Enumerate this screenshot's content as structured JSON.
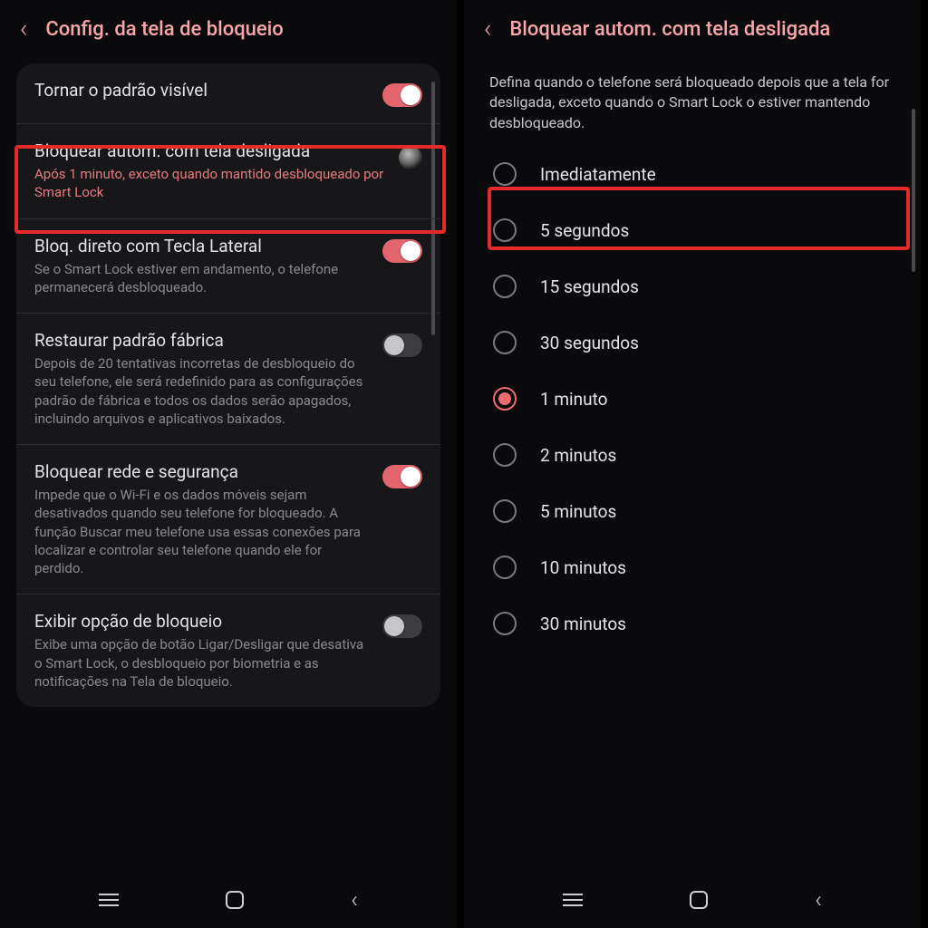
{
  "left": {
    "title": "Config. da tela de bloqueio",
    "items": [
      {
        "title": "Tornar o padrão visível",
        "sub": "",
        "toggle": "on"
      },
      {
        "title": "Bloquear autom. com tela desligada",
        "sub": "Após 1 minuto, exceto quando mantido desbloqueado por Smart Lock",
        "loading": true
      },
      {
        "title": "Bloq. direto com Tecla Lateral",
        "sub": "Se o Smart Lock estiver em andamento, o telefone permanecerá desbloqueado.",
        "toggle": "on"
      },
      {
        "title": "Restaurar padrão fábrica",
        "sub": "Depois de 20 tentativas incorretas de desbloqueio do seu telefone, ele será redefinido para as configurações padrão de fábrica e todos os dados serão apagados, incluindo arquivos e aplicativos baixados.",
        "toggle": "off"
      },
      {
        "title": "Bloquear rede e segurança",
        "sub": "Impede que o Wi-Fi e os dados móveis sejam desativados quando seu telefone for bloqueado. A função Buscar meu telefone usa essas conexões para localizar e controlar seu telefone quando ele for perdido.",
        "toggle": "on"
      },
      {
        "title": "Exibir opção de bloqueio",
        "sub": "Exibe uma opção de botão Ligar/Desligar que desativa o Smart Lock, o desbloqueio por biometria e as notificações na Tela de bloqueio.",
        "toggle": "off"
      }
    ]
  },
  "right": {
    "title": "Bloquear autom. com tela desligada",
    "description": "Defina quando o telefone será bloqueado depois que a tela for desligada, exceto quando o Smart Lock o estiver mantendo desbloqueado.",
    "options": [
      "Imediatamente",
      "5 segundos",
      "15 segundos",
      "30 segundos",
      "1 minuto",
      "2 minutos",
      "5 minutos",
      "10 minutos",
      "30 minutos"
    ],
    "selected_index": 4
  }
}
